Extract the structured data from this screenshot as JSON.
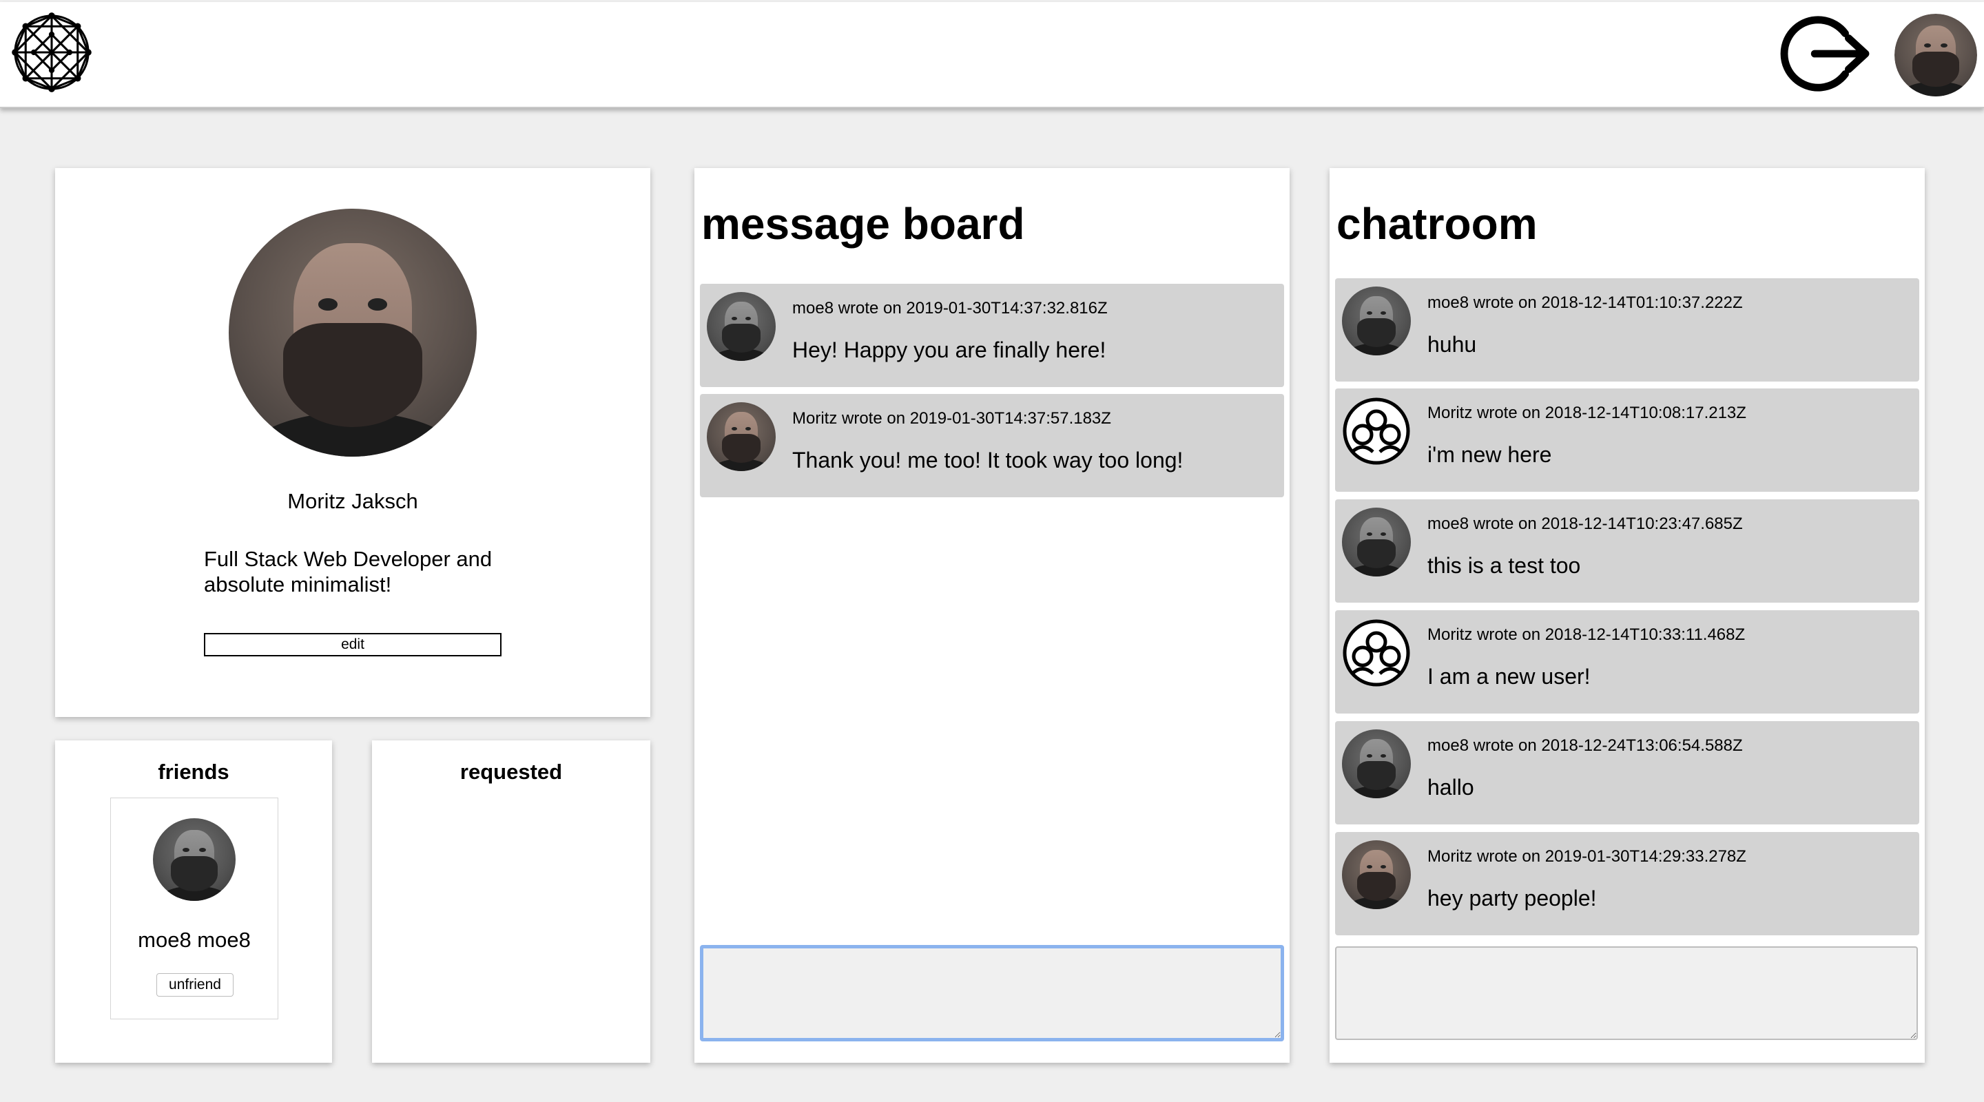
{
  "header": {
    "logo_icon": "network-sphere-logo-icon",
    "logout_icon": "logout-arrow-icon"
  },
  "profile": {
    "name": "Moritz Jaksch",
    "bio": "Full Stack Web Developer and absolute minimalist!",
    "edit_label": "edit"
  },
  "friends": {
    "title": "friends",
    "items": [
      {
        "name": "moe8 moe8",
        "unfriend_label": "unfriend"
      }
    ]
  },
  "requested": {
    "title": "requested"
  },
  "message_board": {
    "title": "message board",
    "messages": [
      {
        "meta": "moe8 wrote on 2019-01-30T14:37:32.816Z",
        "text": "Hey! Happy you are finally here!",
        "avatar": "bw-photo"
      },
      {
        "meta": "Moritz wrote on 2019-01-30T14:37:57.183Z",
        "text": "Thank you! me too! It took way too long!",
        "avatar": "color-photo"
      }
    ],
    "input_value": ""
  },
  "chatroom": {
    "title": "chatroom",
    "messages": [
      {
        "meta": "moe8 wrote on 2018-12-14T01:10:37.222Z",
        "text": "huhu",
        "avatar": "bw-photo"
      },
      {
        "meta": "Moritz wrote on 2018-12-14T10:08:17.213Z",
        "text": "i'm new here",
        "avatar": "group-icon"
      },
      {
        "meta": "moe8 wrote on 2018-12-14T10:23:47.685Z",
        "text": "this is a test too",
        "avatar": "bw-photo"
      },
      {
        "meta": "Moritz wrote on 2018-12-14T10:33:11.468Z",
        "text": "I am a new user!",
        "avatar": "group-icon"
      },
      {
        "meta": "moe8 wrote on 2018-12-24T13:06:54.588Z",
        "text": "hallo",
        "avatar": "bw-photo"
      },
      {
        "meta": "Moritz wrote on 2019-01-30T14:29:33.278Z",
        "text": "hey party people!",
        "avatar": "color-photo"
      }
    ],
    "input_value": ""
  }
}
